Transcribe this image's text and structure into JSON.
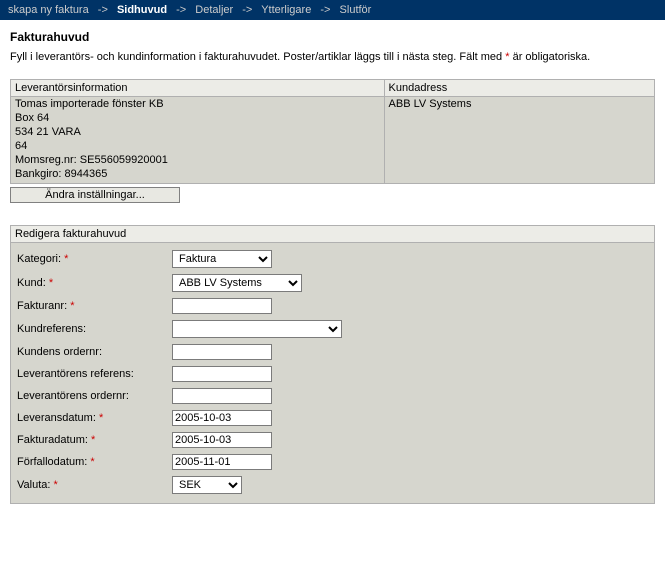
{
  "wizard": {
    "steps": [
      "skapa ny faktura",
      "Sidhuvud",
      "Detaljer",
      "Ytterligare",
      "Slutför"
    ],
    "current_index": 1,
    "arrow": "->"
  },
  "header": {
    "title": "Fakturahuvud",
    "intro_pre": "Fyll i leverantörs- och kundinformation i fakturahuvudet. Poster/artiklar läggs till i nästa steg. Fält med ",
    "intro_mark": "*",
    "intro_post": " är obligatoriska."
  },
  "supplier": {
    "heading": "Leverantörsinformation",
    "name": "Tomas importerade fönster KB",
    "box": "Box 64",
    "postal": "534 21 VARA",
    "country": "64",
    "vat": "Momsreg.nr: SE556059920001",
    "bankgiro": "Bankgiro: 8944365"
  },
  "customer": {
    "heading": "Kundadress",
    "name": "ABB LV Systems"
  },
  "buttons": {
    "change_settings": "Ändra inställningar..."
  },
  "edit_section": {
    "title": "Redigera fakturahuvud"
  },
  "form": {
    "kategori_label": "Kategori:",
    "kategori_value": "Faktura",
    "kund_label": "Kund:",
    "kund_value": "ABB LV Systems",
    "fakturanr_label": "Fakturanr:",
    "fakturanr_value": "",
    "kundreferens_label": "Kundreferens:",
    "kundreferens_value": "",
    "kundens_ordernr_label": "Kundens ordernr:",
    "kundens_ordernr_value": "",
    "lev_referens_label": "Leverantörens referens:",
    "lev_referens_value": "",
    "lev_ordernr_label": "Leverantörens ordernr:",
    "lev_ordernr_value": "",
    "leveransdatum_label": "Leveransdatum:",
    "leveransdatum_value": "2005-10-03",
    "fakturadatum_label": "Fakturadatum:",
    "fakturadatum_value": "2005-10-03",
    "forfallodatum_label": "Förfallodatum:",
    "forfallodatum_value": "2005-11-01",
    "valuta_label": "Valuta:",
    "valuta_value": "SEK"
  }
}
